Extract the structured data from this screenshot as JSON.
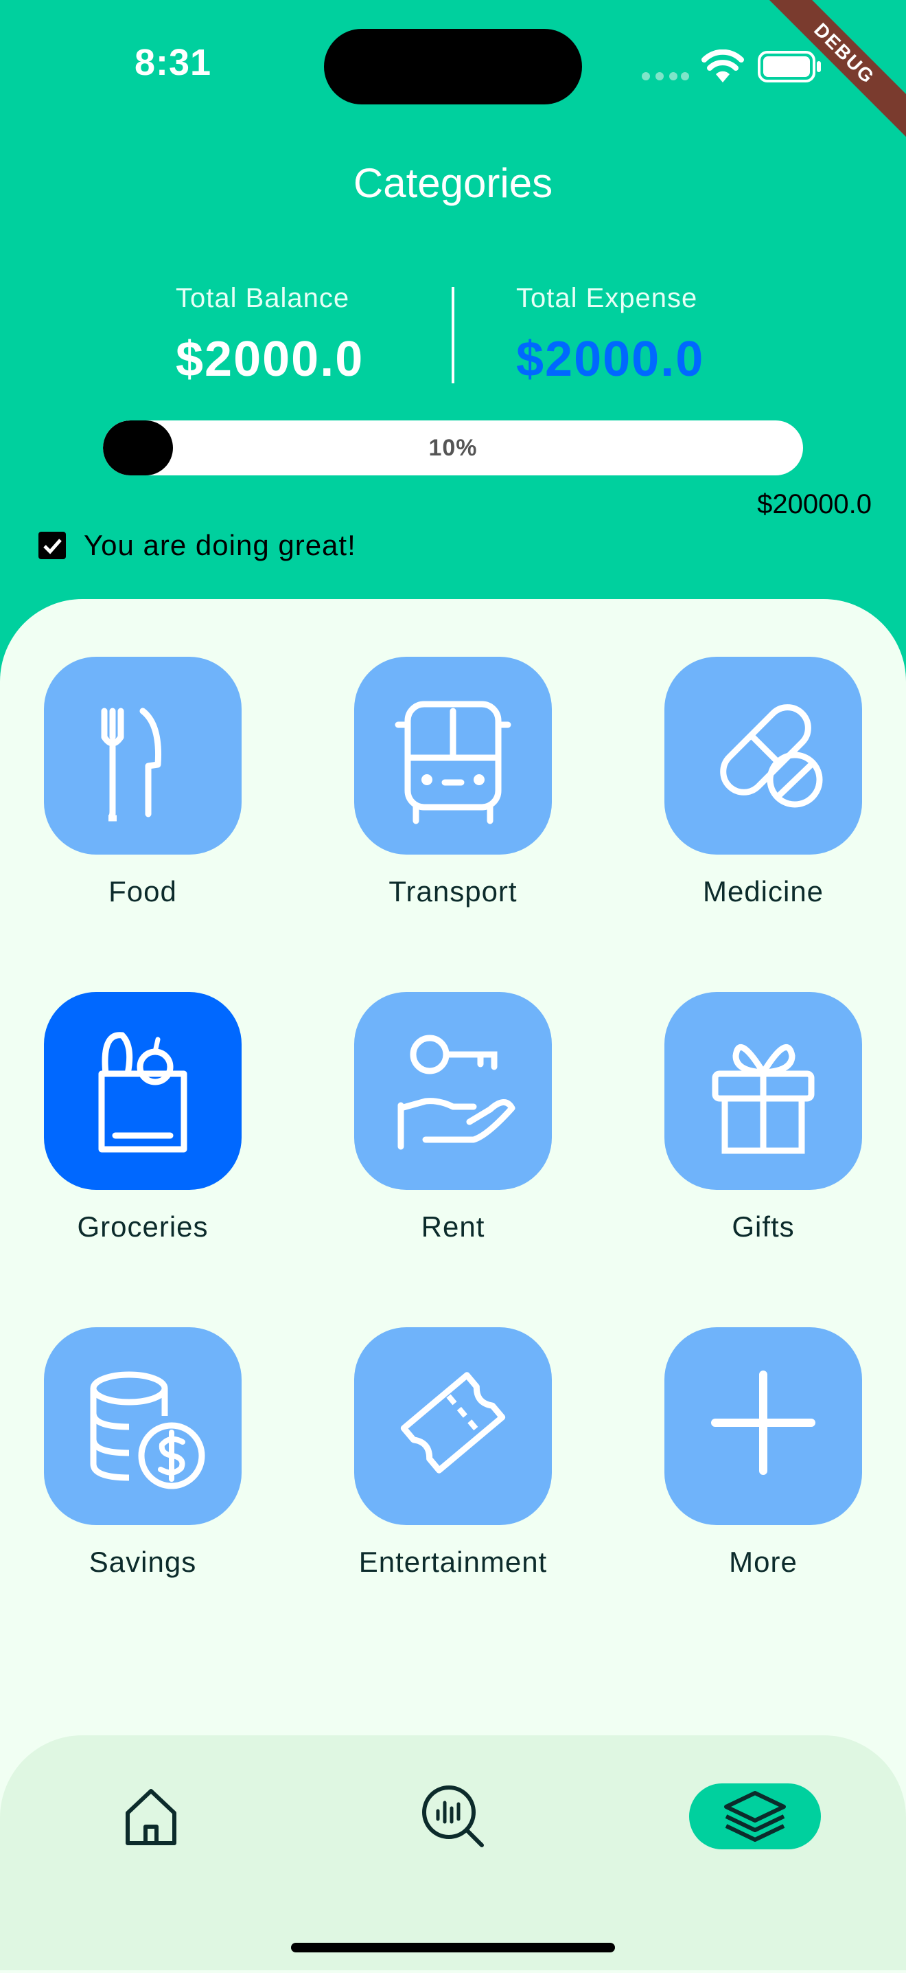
{
  "status_bar": {
    "time": "8:31",
    "debug_label": "DEBUG"
  },
  "header": {
    "title": "Categories"
  },
  "summary": {
    "balance_label": "Total Balance",
    "balance_value": "$2000.0",
    "expense_label": "Total Expense",
    "expense_value": "$2000.0"
  },
  "progress": {
    "percent_text": "10%",
    "fraction": 0.1,
    "limit": "$20000.0"
  },
  "status_message": {
    "checked": true,
    "text": "You are doing great!"
  },
  "categories": [
    {
      "label": "Food",
      "icon": "fork-knife-icon",
      "active": false
    },
    {
      "label": "Transport",
      "icon": "bus-icon",
      "active": false
    },
    {
      "label": "Medicine",
      "icon": "pill-icon",
      "active": false
    },
    {
      "label": "Groceries",
      "icon": "grocery-bag-icon",
      "active": true
    },
    {
      "label": "Rent",
      "icon": "key-hand-icon",
      "active": false
    },
    {
      "label": "Gifts",
      "icon": "gift-icon",
      "active": false
    },
    {
      "label": "Savings",
      "icon": "coins-icon",
      "active": false
    },
    {
      "label": "Entertainment",
      "icon": "ticket-icon",
      "active": false
    },
    {
      "label": "More",
      "icon": "plus-icon",
      "active": false
    }
  ],
  "bottom_nav": [
    {
      "icon": "home-icon",
      "active": false
    },
    {
      "icon": "analysis-icon",
      "active": false
    },
    {
      "icon": "layers-icon",
      "active": true
    }
  ],
  "colors": {
    "primary": "#00D09E",
    "tile": "#6FB3FA",
    "tile_active": "#0068FF",
    "expense": "#0068FF",
    "panel": "#F1FFF3",
    "nav_bg": "#DFF7E2"
  }
}
